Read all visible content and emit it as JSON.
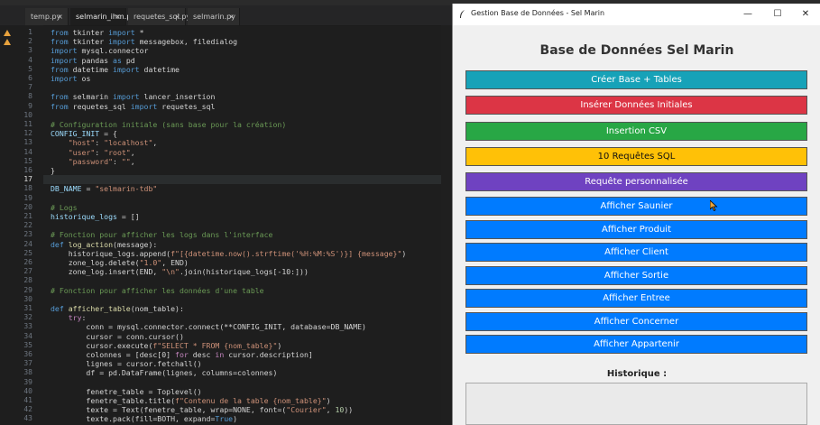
{
  "editor": {
    "tabs": [
      {
        "label": "temp.py",
        "active": false
      },
      {
        "label": "selmarin_ihm.py",
        "active": true
      },
      {
        "label": "requetes_sql.py",
        "active": false
      },
      {
        "label": "selmarin.py",
        "active": false
      }
    ],
    "close_glyph": "×",
    "current_line": 17,
    "line_numbers": [
      "1",
      "2",
      "3",
      "4",
      "5",
      "6",
      "7",
      "8",
      "9",
      "10",
      "11",
      "12",
      "13",
      "14",
      "15",
      "16",
      "17",
      "18",
      "19",
      "20",
      "21",
      "22",
      "23",
      "24",
      "25",
      "26",
      "27",
      "28",
      "29",
      "30",
      "31",
      "32",
      "33",
      "34",
      "35",
      "36",
      "37",
      "38",
      "39",
      "40",
      "41",
      "42",
      "43"
    ],
    "lines": [
      [
        [
          "kw",
          "from "
        ],
        [
          "",
          "tkinter "
        ],
        [
          "kw",
          "import "
        ],
        [
          "",
          "*"
        ]
      ],
      [
        [
          "kw",
          "from "
        ],
        [
          "",
          "tkinter "
        ],
        [
          "kw",
          "import "
        ],
        [
          "",
          "messagebox, filedialog"
        ]
      ],
      [
        [
          "kw",
          "import "
        ],
        [
          "",
          "mysql.connector"
        ]
      ],
      [
        [
          "kw",
          "import "
        ],
        [
          "",
          "pandas "
        ],
        [
          "kw",
          "as "
        ],
        [
          "",
          "pd"
        ]
      ],
      [
        [
          "kw",
          "from "
        ],
        [
          "",
          "datetime "
        ],
        [
          "kw",
          "import "
        ],
        [
          "",
          "datetime"
        ]
      ],
      [
        [
          "kw",
          "import "
        ],
        [
          "",
          "os"
        ]
      ],
      [],
      [
        [
          "kw",
          "from "
        ],
        [
          "",
          "selmarin "
        ],
        [
          "kw",
          "import "
        ],
        [
          "",
          "lancer_insertion"
        ]
      ],
      [
        [
          "kw",
          "from "
        ],
        [
          "",
          "requetes_sql "
        ],
        [
          "kw",
          "import "
        ],
        [
          "",
          "requetes_sql"
        ]
      ],
      [],
      [
        [
          "cm",
          "# Configuration initiale (sans base pour la création)"
        ]
      ],
      [
        [
          "v",
          "CONFIG_INIT"
        ],
        [
          "",
          " = {"
        ]
      ],
      [
        [
          "",
          "    "
        ],
        [
          "str",
          "\"host\""
        ],
        [
          "",
          ": "
        ],
        [
          "str",
          "\"localhost\""
        ],
        [
          "",
          ","
        ]
      ],
      [
        [
          "",
          "    "
        ],
        [
          "str",
          "\"user\""
        ],
        [
          "",
          ": "
        ],
        [
          "str",
          "\"root\""
        ],
        [
          "",
          ","
        ]
      ],
      [
        [
          "",
          "    "
        ],
        [
          "str",
          "\"password\""
        ],
        [
          "",
          ": "
        ],
        [
          "str",
          "\"\""
        ],
        [
          "",
          ","
        ]
      ],
      [
        [
          "",
          "}"
        ]
      ],
      [],
      [
        [
          "v",
          "DB_NAME"
        ],
        [
          "",
          " = "
        ],
        [
          "str",
          "\"selmarin-tdb\""
        ]
      ],
      [],
      [
        [
          "cm",
          "# Logs"
        ]
      ],
      [
        [
          "v",
          "historique_logs"
        ],
        [
          "",
          " = []"
        ]
      ],
      [],
      [
        [
          "cm",
          "# Fonction pour afficher les logs dans l'interface"
        ]
      ],
      [
        [
          "kw",
          "def "
        ],
        [
          "fn",
          "log_action"
        ],
        [
          "",
          "(message):"
        ]
      ],
      [
        [
          "",
          "    historique_logs.append("
        ],
        [
          "str",
          "f\"[{datetime.now().strftime('%H:%M:%S')}] {message}\""
        ],
        [
          "",
          ")"
        ]
      ],
      [
        [
          "",
          "    zone_log.delete("
        ],
        [
          "str",
          "\"1.0\""
        ],
        [
          "",
          ", END)"
        ]
      ],
      [
        [
          "",
          "    zone_log.insert(END, "
        ],
        [
          "str",
          "\"\\n\""
        ],
        [
          "",
          ".join(historique_logs[-10:]))"
        ]
      ],
      [],
      [
        [
          "cm",
          "# Fonction pour afficher les données d'une table"
        ]
      ],
      [],
      [
        [
          "kw",
          "def "
        ],
        [
          "fn",
          "afficher_table"
        ],
        [
          "",
          "(nom_table):"
        ]
      ],
      [
        [
          "",
          "    "
        ],
        [
          "kw2",
          "try"
        ],
        [
          "",
          ":"
        ]
      ],
      [
        [
          "",
          "        conn = mysql.connector.connect(**CONFIG_INIT, database=DB_NAME)"
        ]
      ],
      [
        [
          "",
          "        cursor = conn.cursor()"
        ]
      ],
      [
        [
          "",
          "        cursor.execute("
        ],
        [
          "str",
          "f\"SELECT * FROM {nom_table}\""
        ],
        [
          "",
          ")"
        ]
      ],
      [
        [
          "",
          "        colonnes = [desc[0] "
        ],
        [
          "kw2",
          "for "
        ],
        [
          "",
          "desc "
        ],
        [
          "kw2",
          "in "
        ],
        [
          "",
          "cursor.description]"
        ]
      ],
      [
        [
          "",
          "        lignes = cursor.fetchall()"
        ]
      ],
      [
        [
          "",
          "        df = pd.DataFrame(lignes, columns=colonnes)"
        ]
      ],
      [],
      [
        [
          "",
          "        fenetre_table = Toplevel()"
        ]
      ],
      [
        [
          "",
          "        fenetre_table.title("
        ],
        [
          "str",
          "f\"Contenu de la table {nom_table}\""
        ],
        [
          "",
          ")"
        ]
      ],
      [
        [
          "",
          "        texte = Text(fenetre_table, wrap=NONE, font=("
        ],
        [
          "str",
          "\"Courier\""
        ],
        [
          "",
          ", "
        ],
        [
          "num",
          "10"
        ],
        [
          "",
          "))"
        ]
      ],
      [
        [
          "",
          "        texte.pack(fill=BOTH, expand="
        ],
        [
          "kw",
          "True"
        ],
        [
          "",
          ")"
        ]
      ]
    ]
  },
  "app": {
    "window_title": "Gestion Base de Données - Sel Marin",
    "controls": {
      "minimize": "—",
      "maximize": "☐",
      "close": "✕"
    },
    "heading": "Base de Données Sel Marin",
    "buttons": [
      {
        "label": "Créer Base + Tables",
        "color": "#17a2b8"
      },
      {
        "label": "Insérer Données Initiales",
        "color": "#dc3545"
      },
      {
        "label": "Insertion CSV",
        "color": "#28a745"
      },
      {
        "label": "10 Requêtes SQL",
        "color": "#ffc107"
      },
      {
        "label": "Requête personnalisée",
        "color": "#6f42c1"
      },
      {
        "label": "Afficher Saunier",
        "color": "#007bff"
      },
      {
        "label": "Afficher Produit",
        "color": "#007bff"
      },
      {
        "label": "Afficher Client",
        "color": "#007bff"
      },
      {
        "label": "Afficher Sortie",
        "color": "#007bff"
      },
      {
        "label": "Afficher Entree",
        "color": "#007bff"
      },
      {
        "label": "Afficher Concerner",
        "color": "#007bff"
      },
      {
        "label": "Afficher Appartenir",
        "color": "#007bff"
      }
    ],
    "history_label": "Historique :"
  }
}
